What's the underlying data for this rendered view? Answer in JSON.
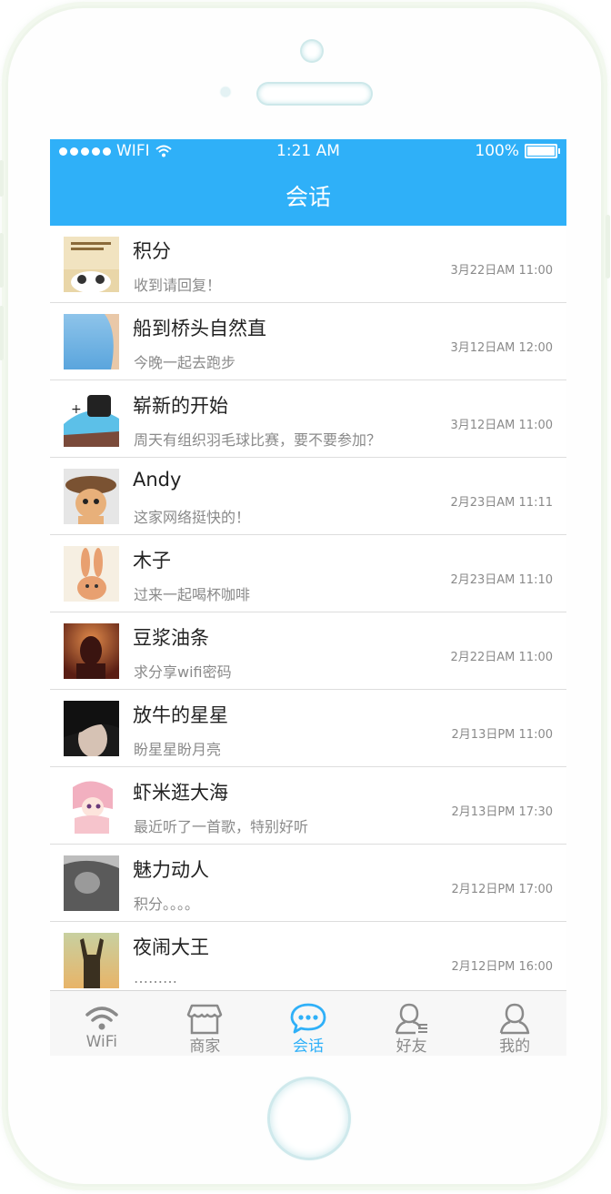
{
  "status_bar": {
    "carrier": "WIFI",
    "time": "1:21 AM",
    "battery": "100%"
  },
  "header": {
    "title": "会话"
  },
  "conversations": [
    {
      "name": "积分",
      "message": "收到请回复！",
      "date": "3月22日AM 11:00"
    },
    {
      "name": "船到桥头自然直",
      "message": "今晚一起去跑步",
      "date": "3月12日AM 12:00"
    },
    {
      "name": "崭新的开始",
      "message": "周天有组织羽毛球比赛，要不要参加？",
      "date": "3月12日AM 11:00"
    },
    {
      "name": "Andy",
      "message": "这家网络挺快的！",
      "date": "2月23日AM 11:11"
    },
    {
      "name": "木子",
      "message": "过来一起喝杯咖啡",
      "date": "2月23日AM 11:10"
    },
    {
      "name": "豆浆油条",
      "message": "求分享wifi密码",
      "date": "2月22日AM 11:00"
    },
    {
      "name": "放牛的星星",
      "message": "盼星星盼月亮",
      "date": "2月13日PM 11:00"
    },
    {
      "name": "虾米逛大海",
      "message": "最近听了一首歌，特别好听",
      "date": "2月13日PM 17:30"
    },
    {
      "name": "魅力动人",
      "message": "积分。。。。",
      "date": "2月12日PM 17:00"
    },
    {
      "name": "夜闹大王",
      "message": "………",
      "date": "2月12日PM 16:00"
    }
  ],
  "tabs": [
    {
      "label": "WiFi",
      "icon": "wifi-icon",
      "active": false
    },
    {
      "label": "商家",
      "icon": "shop-icon",
      "active": false
    },
    {
      "label": "会话",
      "icon": "chat-bubble-icon",
      "active": true
    },
    {
      "label": "好友",
      "icon": "friends-icon",
      "active": false
    },
    {
      "label": "我的",
      "icon": "user-icon",
      "active": false
    }
  ],
  "colors": {
    "accent": "#2fb0f8",
    "text_muted": "#8a8a8a"
  }
}
